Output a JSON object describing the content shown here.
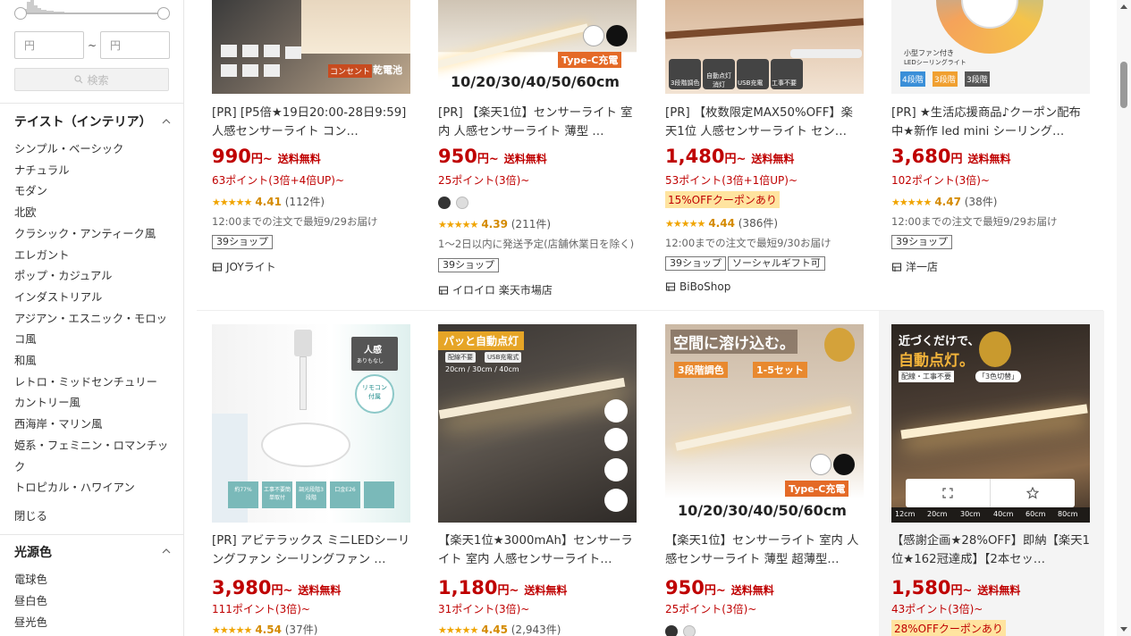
{
  "sidebar": {
    "price_min_placeholder": "円",
    "price_max_placeholder": "円",
    "tilde": "~",
    "search_label": "検索",
    "taste_title": "テイスト（インテリア）",
    "taste_items": [
      "シンプル・ベーシック",
      "ナチュラル",
      "モダン",
      "北欧",
      "クラシック・アンティーク風",
      "エレガント",
      "ポップ・カジュアル",
      "インダストリアル",
      "アジアン・エスニック・モロッ",
      "コ風",
      "和風",
      "レトロ・ミッドセンチュリー",
      "カントリー風",
      "西海岸・マリン風",
      "姫系・フェミニン・ロマンチッ",
      "ク",
      "トロピカル・ハワイアン"
    ],
    "close_label": "閉じる",
    "light_title": "光源色",
    "light_items": [
      "電球色",
      "昼白色",
      "昼光色"
    ]
  },
  "products": [
    {
      "title": "[PR] [P5倍★19日20:00-28日9:59]人感センサーライト コン…",
      "price": "990",
      "yen": "円~",
      "shipping": "送料無料",
      "points": "63ポイント(3倍+4倍UP)~",
      "rating_stars": "★★★★★",
      "rating": "4.41",
      "reviews": "(112件)",
      "delivery": "12:00までの注文で最短9/29お届け",
      "tags": [
        "39ショップ"
      ],
      "shop": "JOYライト",
      "img_texts": [
        "コンセント",
        "乾電池"
      ]
    },
    {
      "title": "[PR] 【楽天1位】センサーライト 室内 人感センサーライト 薄型 …",
      "price": "950",
      "yen": "円~",
      "shipping": "送料無料",
      "points": "25ポイント(3倍)~",
      "rating_stars": "★★★★★",
      "rating": "4.39",
      "reviews": "(211件)",
      "delivery": "1～2日以内に発送予定(店舗休業日を除く)",
      "tags": [
        "39ショップ"
      ],
      "shop": "イロイロ 楽天市場店",
      "img_texts": [
        "Type-C充電",
        "10/20/30/40/50/60cm"
      ]
    },
    {
      "title": "[PR] 【枚数限定MAX50%OFF】楽天1位 人感センサーライト セン…",
      "price": "1,480",
      "yen": "円~",
      "shipping": "送料無料",
      "points": "53ポイント(3倍+1倍UP)~",
      "coupon": "15%OFFクーポンあり",
      "rating_stars": "★★★★★",
      "rating": "4.44",
      "reviews": "(386件)",
      "delivery": "12:00までの注文で最短9/30お届け",
      "tags": [
        "39ショップ",
        "ソーシャルギフト可"
      ],
      "shop": "BiBoShop",
      "img_texts": [
        "3段階調色",
        "自動点灯消灯",
        "USB充電",
        "工事不要"
      ]
    },
    {
      "title": "[PR] ★生活応援商品♪クーポン配布中★新作 led mini シーリング…",
      "price": "3,680",
      "yen": "円",
      "shipping": "送料無料",
      "points": "102ポイント(3倍)~",
      "rating_stars": "★★★★★",
      "rating": "4.47",
      "reviews": "(38件)",
      "delivery": "12:00までの注文で最短9/29お届け",
      "tags": [
        "39ショップ"
      ],
      "shop": "洋一店",
      "img_texts": [
        "小型ファン付き",
        "LEDシーリングライト",
        "4段階",
        "3段階",
        "3段階"
      ]
    },
    {
      "title": "[PR] アビテラックス ミニLEDシーリングファン シーリングファン …",
      "price": "3,980",
      "yen": "円~",
      "shipping": "送料無料",
      "points": "111ポイント(3倍)~",
      "rating_stars": "★★★★★",
      "rating": "4.54",
      "reviews": "(37件)",
      "img_texts": [
        "人感",
        "ありもなし",
        "リモコン付属",
        "約77%",
        "工事不要簡単取付",
        "調光段階3段階",
        "口金E26"
      ]
    },
    {
      "title": "【楽天1位★3000mAh】センサーライト 室内 人感センサーライト…",
      "price": "1,180",
      "yen": "円~",
      "shipping": "送料無料",
      "points": "31ポイント(3倍)~",
      "rating_stars": "★★★★★",
      "rating": "4.45",
      "reviews": "(2,943件)",
      "img_texts": [
        "パッと自動点灯",
        "配線不要",
        "USB充電式",
        "20cm / 30cm / 40cm"
      ]
    },
    {
      "title": "【楽天1位】センサーライト 室内 人感センサーライト 薄型 超薄型…",
      "price": "950",
      "yen": "円~",
      "shipping": "送料無料",
      "points": "25ポイント(3倍)~",
      "img_texts": [
        "空間に溶け込む。",
        "3段階調色",
        "1-5セット",
        "Type-C充電",
        "10/20/30/40/50/60cm"
      ]
    },
    {
      "title": "【感謝企画★28%OFF】即納【楽天1位★162冠達成】【2本セッ…",
      "price": "1,580",
      "yen": "円~",
      "shipping": "送料無料",
      "points": "43ポイント(3倍)~",
      "coupon": "28%OFFクーポンあり",
      "img_texts": [
        "近づくだけで、",
        "自動点灯。",
        "配線・工事不要",
        "「3色切替」",
        "12cm",
        "20cm",
        "30cm",
        "40cm",
        "60cm",
        "80cm"
      ]
    }
  ],
  "colors": {
    "price_red": "#bf0000",
    "star": "#f0a400",
    "coupon_bg": "#ffe4a0"
  }
}
